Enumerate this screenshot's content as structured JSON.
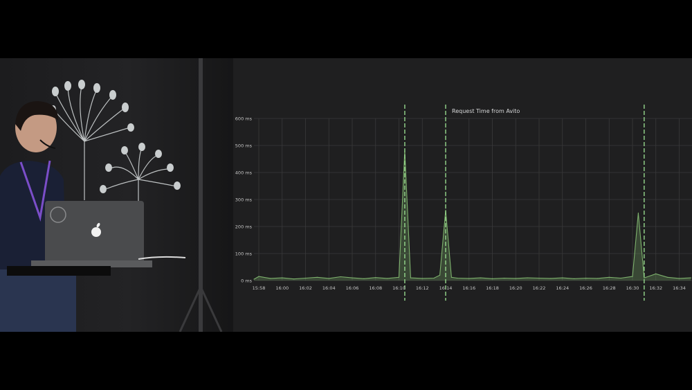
{
  "chart_data": {
    "type": "area",
    "title": "Request Time from Avito",
    "y_unit": "ms",
    "ylim": [
      0,
      600
    ],
    "y_ticks": [
      0,
      100,
      200,
      300,
      400,
      500,
      600
    ],
    "y_tick_labels": [
      "0 ms",
      "100 ms",
      "200 ms",
      "300 ms",
      "400 ms",
      "500 ms",
      "600 ms"
    ],
    "x_tick_labels": [
      "15:58",
      "16:00",
      "16:02",
      "16:04",
      "16:06",
      "16:08",
      "16:10",
      "16:12",
      "16:14",
      "16:16",
      "16:18",
      "16:20",
      "16:22",
      "16:24",
      "16:26",
      "16:28",
      "16:30",
      "16:32",
      "16:34"
    ],
    "grid": true,
    "series": [
      {
        "color": "#7eb26d",
        "x": [
          "15:57",
          "15:58",
          "15:59",
          "16:00",
          "16:01",
          "16:02",
          "16:03",
          "16:04",
          "16:05",
          "16:06",
          "16:07",
          "16:08",
          "16:09",
          "16:10",
          "16:10:30",
          "16:11",
          "16:12",
          "16:13",
          "16:13:30",
          "16:14",
          "16:14:30",
          "16:15",
          "16:16",
          "16:17",
          "16:18",
          "16:19",
          "16:20",
          "16:21",
          "16:22",
          "16:23",
          "16:24",
          "16:25",
          "16:26",
          "16:27",
          "16:28",
          "16:29",
          "16:30",
          "16:30:30",
          "16:31",
          "16:32",
          "16:33",
          "16:34",
          "16:35"
        ],
        "values": [
          5,
          15,
          8,
          10,
          6,
          9,
          12,
          8,
          14,
          10,
          7,
          11,
          8,
          12,
          480,
          10,
          8,
          9,
          20,
          260,
          12,
          9,
          8,
          10,
          7,
          9,
          8,
          10,
          9,
          8,
          10,
          7,
          9,
          8,
          12,
          9,
          15,
          250,
          10,
          25,
          12,
          8,
          10
        ]
      }
    ],
    "annotations": [
      "16:10:30",
      "16:14",
      "16:31"
    ],
    "annotation_color": "#96d98d"
  },
  "scene": {
    "laptop_logo": "apple-logo-icon",
    "microphone": "headset-microphone-icon",
    "wall_art": "dandelion-icon"
  }
}
